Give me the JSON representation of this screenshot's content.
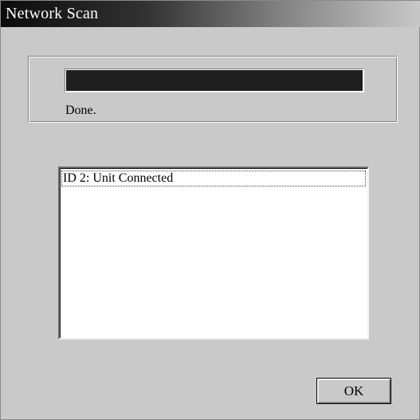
{
  "window": {
    "title": "Network Scan"
  },
  "progress": {
    "value": 1.0,
    "status": "Done."
  },
  "results": {
    "items": [
      {
        "label": "ID 2: Unit Connected",
        "selected": true
      }
    ]
  },
  "buttons": {
    "ok_label": "OK"
  },
  "colors": {
    "window_bg": "#c9c9c9",
    "progress_fill": "#1f1f1f",
    "listbox_bg": "#ffffff"
  }
}
